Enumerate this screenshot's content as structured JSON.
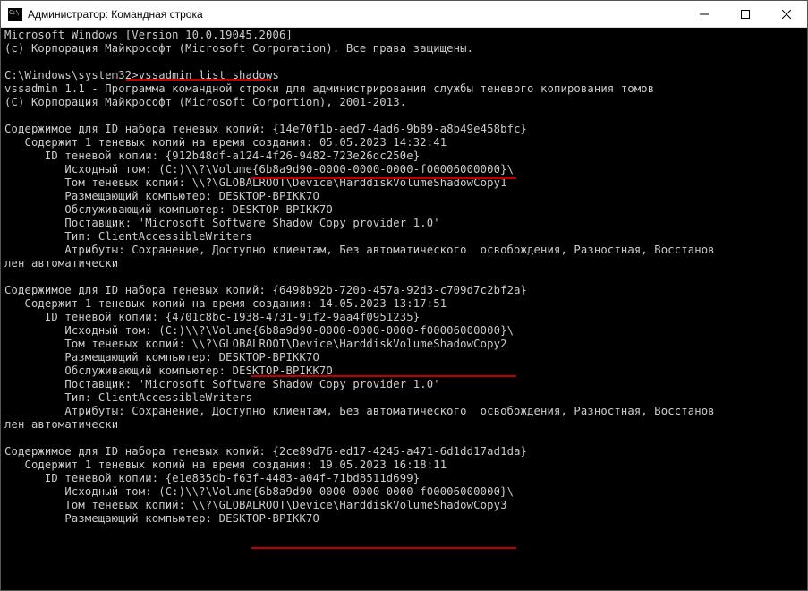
{
  "titlebar": {
    "title": "Администратор: Командная строка"
  },
  "console": {
    "header1": "Microsoft Windows [Version 10.0.19045.2006]",
    "header2": "(c) Корпорация Майкрософт (Microsoft Corporation). Все права защищены.",
    "prompt": "C:\\Windows\\system32>",
    "command": "vssadmin list shadows",
    "tool1": "vssadmin 1.1 - Программа командной строки для администрирования службы теневого копирования томов",
    "tool2": "(C) Корпорация Майкрософт (Microsoft Corportion), 2001-2013.",
    "set_label": "Содержимое для ID набора теневых копий:",
    "contains_prefix": "   Содержит 1 теневых копий на время создания:",
    "copy_id_label": "      ID теневой копии:",
    "orig_vol_label": "         Исходный том: (C:)\\\\?\\Volume",
    "shadow_vol_label": "         Том теневых копий:",
    "host_label": "         Размещающий компьютер:",
    "service_label": "         Обслуживающий компьютер:",
    "provider_label": "         Поставщик:",
    "type_label": "         Тип:",
    "type_val": "ClientAccessibleWriters",
    "attr_line1": "         Атрибуты: Сохранение, Доступно клиентам, Без автоматического  освобождения, Разностная, Восстанов",
    "attr_line2": "лен автоматически",
    "provider_val": "'Microsoft Software Shadow Copy provider 1.0'",
    "vol_guid": "{6b8a9d90-0000-0000-0000-f00006000000}\\",
    "computer": "DESKTOP-BPIKK7O",
    "sets": [
      {
        "set_id": "{14e70f1b-aed7-4ad6-9b89-a8b49e458bfc}",
        "created": "05.05.2023 14:32:41",
        "copy_id": "{912b48df-a124-4f26-9482-723e26dc250e}",
        "shadow_vol": "\\\\?\\GLOBALROOT\\Device\\HarddiskVolumeShadowCopy1"
      },
      {
        "set_id": "{6498b92b-720b-457a-92d3-c709d7c2bf2a}",
        "created": "14.05.2023 13:17:51",
        "copy_id": "{4701c8bc-1938-4731-91f2-9aa4f0951235}",
        "shadow_vol": "\\\\?\\GLOBALROOT\\Device\\HarddiskVolumeShadowCopy2"
      },
      {
        "set_id": "{2ce89d76-ed17-4245-a471-6d1dd17ad1da}",
        "created": "19.05.2023 16:18:11",
        "copy_id": "{e1e835db-f63f-4483-a04f-71bd8511d699}",
        "shadow_vol": "\\\\?\\GLOBALROOT\\Device\\HarddiskVolumeShadowCopy3"
      }
    ]
  }
}
